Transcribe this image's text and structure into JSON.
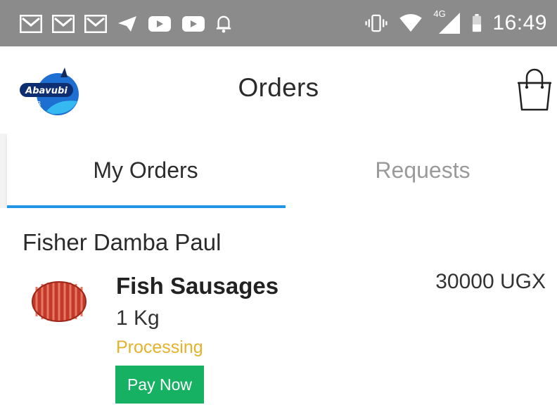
{
  "status_bar": {
    "left_icons": [
      "gmail-icon",
      "gmail-icon",
      "gmail-icon",
      "telegram-icon",
      "youtube-icon",
      "youtube-icon",
      "bell-icon"
    ],
    "right_icons": [
      "vibrate-icon",
      "wifi-icon",
      "signal-4g-icon",
      "battery-icon"
    ],
    "network_label": "4G",
    "time": "16:49"
  },
  "app_bar": {
    "logo_icon": "abavubi-fisher-logo-icon",
    "logo_text": "Abavubi",
    "logo_subtext": "FISHER",
    "title": "Orders",
    "cart_icon": "shopping-bag-icon"
  },
  "tabs": [
    {
      "label": "My Orders",
      "active": true
    },
    {
      "label": "Requests",
      "active": false
    }
  ],
  "order": {
    "fisher": "Fisher Damba Paul",
    "product_icon": "sausage-product-image",
    "product_name": "Fish Sausages",
    "quantity": "1 Kg",
    "price": "30000 UGX",
    "status": "Processing",
    "pay_label": "Pay Now"
  },
  "colors": {
    "status_bar": "#8b8b8b",
    "tab_indicator": "#2395e6",
    "status_processing": "#e6b12b",
    "pay_button": "#17b164"
  }
}
